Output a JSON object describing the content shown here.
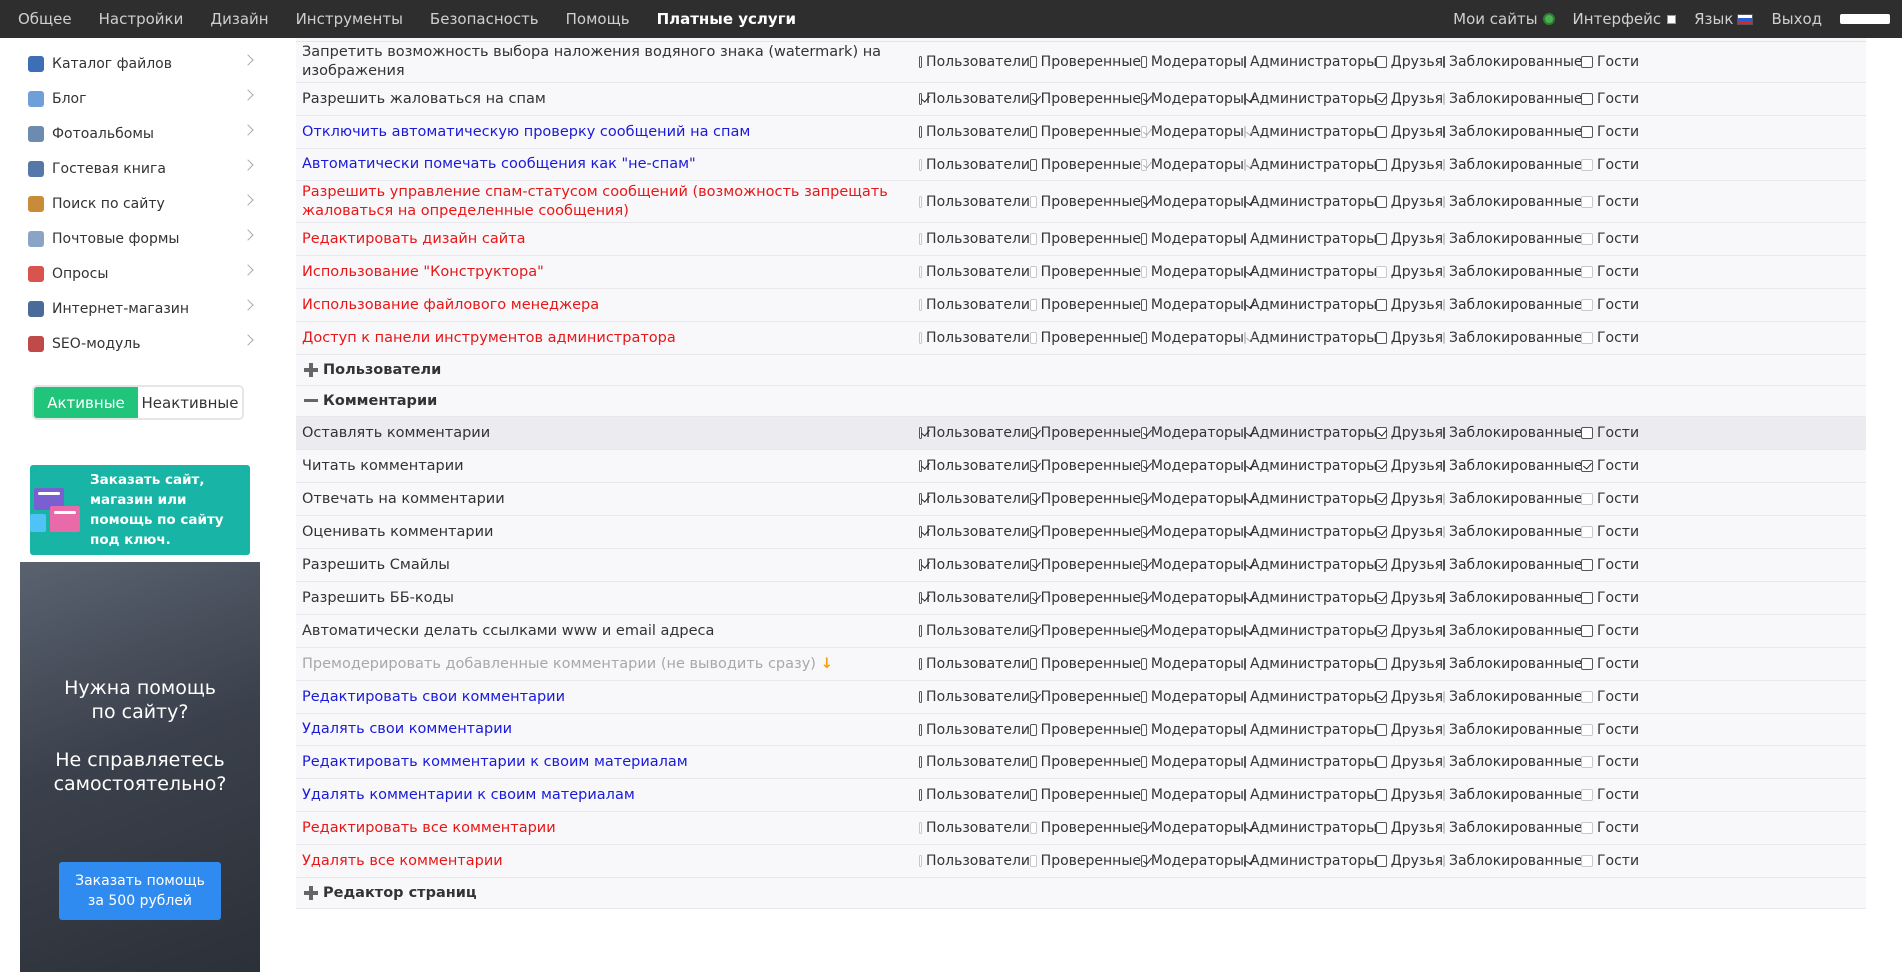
{
  "topnav": {
    "items": [
      "Общее",
      "Настройки",
      "Дизайн",
      "Инструменты",
      "Безопасность",
      "Помощь"
    ],
    "paid": "Платные услуги"
  },
  "topright": {
    "my_sites": "Мои сайты",
    "interface": "Интерфейс",
    "language": "Язык",
    "logout": "Выход"
  },
  "sidebar": {
    "items": [
      {
        "label": "Каталог файлов",
        "icon": "file-catalog-icon",
        "color": "#3d6fb6"
      },
      {
        "label": "Блог",
        "icon": "blog-icon",
        "color": "#6f9fd8"
      },
      {
        "label": "Фотоальбомы",
        "icon": "photo-album-icon",
        "color": "#6b8bb0"
      },
      {
        "label": "Гостевая книга",
        "icon": "guestbook-icon",
        "color": "#5577aa"
      },
      {
        "label": "Поиск по сайту",
        "icon": "search-icon",
        "color": "#c98a3a"
      },
      {
        "label": "Почтовые формы",
        "icon": "mail-form-icon",
        "color": "#8aa4c8"
      },
      {
        "label": "Опросы",
        "icon": "poll-icon",
        "color": "#d9534f"
      },
      {
        "label": "Интернет-магазин",
        "icon": "shop-icon",
        "color": "#4a6a9a"
      },
      {
        "label": "SEO-модуль",
        "icon": "seo-rocket-icon",
        "color": "#c04a4a"
      }
    ],
    "toggle_active": "Активные",
    "toggle_inactive": "Неактивные",
    "promo1": "Заказать сайт, магазин или помощь по сайту под ключ.",
    "promo2_q1_line1": "Нужна помощь",
    "promo2_q1_line2": "по сайту?",
    "promo2_q2_line1": "Не справляетесь",
    "promo2_q2_line2": "самостоятельно?",
    "promo2_btn_line1": "Заказать помощь",
    "promo2_btn_line2": "за 500 рублей"
  },
  "roles": [
    "Пользователи",
    "Проверенные",
    "Модераторы",
    "Администраторы",
    "Друзья",
    "Заблокированные",
    "Гости"
  ],
  "colors": {
    "blue": "#1a1ad9",
    "red": "#e81717",
    "gray": "#a8a8a8",
    "accent": "#20c47a"
  },
  "rows": [
    {
      "type": "row",
      "label": "Запретить возможность выбора наложения водяного знака (watermark) на изображения",
      "color": "normal",
      "h": 41,
      "checks": [
        [
          0,
          0
        ],
        [
          0,
          0
        ],
        [
          0,
          0
        ],
        [
          0,
          0
        ],
        [
          0,
          0
        ],
        [
          0,
          0
        ],
        [
          0,
          0
        ]
      ]
    },
    {
      "type": "row",
      "label": "Разрешить жаловаться на спам",
      "color": "normal",
      "h": 33,
      "checks": [
        [
          1,
          0
        ],
        [
          1,
          0
        ],
        [
          1,
          0
        ],
        [
          1,
          0
        ],
        [
          1,
          0
        ],
        [
          0,
          1
        ],
        [
          0,
          0
        ]
      ]
    },
    {
      "type": "row",
      "label": "Отключить автоматическую проверку сообщений на спам",
      "color": "blue",
      "h": 33,
      "checks": [
        [
          0,
          0
        ],
        [
          0,
          0
        ],
        [
          1,
          1
        ],
        [
          1,
          1
        ],
        [
          0,
          0
        ],
        [
          0,
          0
        ],
        [
          0,
          0
        ]
      ]
    },
    {
      "type": "row",
      "label": "Автоматически помечать сообщения как \"не-спам\"",
      "color": "blue",
      "h": 32,
      "checks": [
        [
          0,
          1
        ],
        [
          0,
          0
        ],
        [
          1,
          1
        ],
        [
          1,
          1
        ],
        [
          0,
          0
        ],
        [
          0,
          1
        ],
        [
          0,
          1
        ]
      ]
    },
    {
      "type": "row",
      "label": "Разрешить управление спам-статусом сообщений (возможность запрещать жаловаться на определенные сообщения)",
      "color": "red",
      "h": 42,
      "checks": [
        [
          0,
          1
        ],
        [
          0,
          1
        ],
        [
          1,
          0
        ],
        [
          1,
          0
        ],
        [
          0,
          0
        ],
        [
          0,
          1
        ],
        [
          0,
          1
        ]
      ]
    },
    {
      "type": "row",
      "label": "Редактировать дизайн сайта",
      "color": "red",
      "h": 33,
      "checks": [
        [
          0,
          1
        ],
        [
          0,
          1
        ],
        [
          0,
          0
        ],
        [
          0,
          0
        ],
        [
          0,
          0
        ],
        [
          0,
          1
        ],
        [
          0,
          1
        ]
      ]
    },
    {
      "type": "row",
      "label": "Использование \"Конструктора\"",
      "color": "red",
      "h": 33,
      "checks": [
        [
          0,
          1
        ],
        [
          0,
          1
        ],
        [
          0,
          1
        ],
        [
          1,
          0
        ],
        [
          0,
          1
        ],
        [
          0,
          1
        ],
        [
          0,
          1
        ]
      ]
    },
    {
      "type": "row",
      "label": "Использование файлового менеджера",
      "color": "red",
      "h": 33,
      "checks": [
        [
          0,
          1
        ],
        [
          0,
          1
        ],
        [
          0,
          0
        ],
        [
          1,
          0
        ],
        [
          0,
          0
        ],
        [
          0,
          1
        ],
        [
          0,
          1
        ]
      ]
    },
    {
      "type": "row",
      "label": "Доступ к панели инструментов администратора",
      "color": "red",
      "h": 33,
      "checks": [
        [
          0,
          1
        ],
        [
          0,
          1
        ],
        [
          0,
          0
        ],
        [
          1,
          1
        ],
        [
          0,
          0
        ],
        [
          0,
          1
        ],
        [
          0,
          1
        ]
      ]
    },
    {
      "type": "group",
      "label": "Пользователи",
      "icon": "plus"
    },
    {
      "type": "group",
      "label": "Комментарии",
      "icon": "minus"
    },
    {
      "type": "row",
      "label": "Оставлять комментарии",
      "color": "normal",
      "h": 33,
      "hl": true,
      "checks": [
        [
          1,
          0
        ],
        [
          1,
          0
        ],
        [
          1,
          0
        ],
        [
          1,
          0
        ],
        [
          1,
          0
        ],
        [
          0,
          0
        ],
        [
          0,
          0
        ]
      ]
    },
    {
      "type": "row",
      "label": "Читать комментарии",
      "color": "normal",
      "h": 33,
      "checks": [
        [
          1,
          0
        ],
        [
          1,
          0
        ],
        [
          1,
          0
        ],
        [
          1,
          0
        ],
        [
          1,
          0
        ],
        [
          0,
          0
        ],
        [
          1,
          0
        ]
      ]
    },
    {
      "type": "row",
      "label": "Отвечать на комментарии",
      "color": "normal",
      "h": 33,
      "checks": [
        [
          1,
          0
        ],
        [
          1,
          0
        ],
        [
          1,
          0
        ],
        [
          1,
          0
        ],
        [
          1,
          0
        ],
        [
          0,
          1
        ],
        [
          0,
          1
        ]
      ]
    },
    {
      "type": "row",
      "label": "Оценивать комментарии",
      "color": "normal",
      "h": 33,
      "checks": [
        [
          1,
          0
        ],
        [
          1,
          0
        ],
        [
          1,
          0
        ],
        [
          1,
          0
        ],
        [
          1,
          0
        ],
        [
          0,
          1
        ],
        [
          0,
          1
        ]
      ]
    },
    {
      "type": "row",
      "label": "Разрешить Смайлы",
      "color": "normal",
      "h": 33,
      "checks": [
        [
          1,
          0
        ],
        [
          1,
          0
        ],
        [
          1,
          0
        ],
        [
          1,
          0
        ],
        [
          1,
          0
        ],
        [
          0,
          0
        ],
        [
          0,
          0
        ]
      ]
    },
    {
      "type": "row",
      "label": "Разрешить ББ-коды",
      "color": "normal",
      "h": 33,
      "checks": [
        [
          1,
          0
        ],
        [
          1,
          0
        ],
        [
          1,
          0
        ],
        [
          1,
          0
        ],
        [
          1,
          0
        ],
        [
          0,
          0
        ],
        [
          0,
          0
        ]
      ]
    },
    {
      "type": "row",
      "label": "Автоматически делать ссылками www и email адреса",
      "color": "normal",
      "h": 33,
      "checks": [
        [
          0,
          0
        ],
        [
          1,
          0
        ],
        [
          1,
          0
        ],
        [
          1,
          0
        ],
        [
          1,
          0
        ],
        [
          0,
          0
        ],
        [
          0,
          0
        ]
      ]
    },
    {
      "type": "row",
      "label": "Премодерировать добавленные комментарии (не выводить сразу)",
      "color": "gray",
      "h": 33,
      "arrow": "↓",
      "checks": [
        [
          0,
          0
        ],
        [
          0,
          0
        ],
        [
          0,
          0
        ],
        [
          0,
          0
        ],
        [
          0,
          0
        ],
        [
          0,
          0
        ],
        [
          0,
          0
        ]
      ]
    },
    {
      "type": "row",
      "label": "Редактировать свои комментарии",
      "color": "blue",
      "h": 33,
      "checks": [
        [
          0,
          0
        ],
        [
          1,
          0
        ],
        [
          0,
          0
        ],
        [
          0,
          0
        ],
        [
          1,
          0
        ],
        [
          0,
          1
        ],
        [
          0,
          1
        ]
      ]
    },
    {
      "type": "row",
      "label": "Удалять свои комментарии",
      "color": "blue",
      "h": 32,
      "checks": [
        [
          0,
          0
        ],
        [
          0,
          0
        ],
        [
          0,
          0
        ],
        [
          0,
          0
        ],
        [
          0,
          0
        ],
        [
          0,
          1
        ],
        [
          0,
          1
        ]
      ]
    },
    {
      "type": "row",
      "label": "Редактировать комментарии к своим материалам",
      "color": "blue",
      "h": 33,
      "checks": [
        [
          0,
          0
        ],
        [
          0,
          0
        ],
        [
          0,
          0
        ],
        [
          0,
          0
        ],
        [
          0,
          0
        ],
        [
          0,
          1
        ],
        [
          0,
          1
        ]
      ]
    },
    {
      "type": "row",
      "label": "Удалять комментарии к своим материалам",
      "color": "blue",
      "h": 33,
      "checks": [
        [
          0,
          0
        ],
        [
          0,
          0
        ],
        [
          0,
          0
        ],
        [
          0,
          0
        ],
        [
          0,
          0
        ],
        [
          0,
          1
        ],
        [
          0,
          1
        ]
      ]
    },
    {
      "type": "row",
      "label": "Редактировать все комментарии",
      "color": "red",
      "h": 33,
      "checks": [
        [
          0,
          1
        ],
        [
          0,
          1
        ],
        [
          1,
          0
        ],
        [
          1,
          0
        ],
        [
          0,
          0
        ],
        [
          0,
          1
        ],
        [
          0,
          1
        ]
      ]
    },
    {
      "type": "row",
      "label": "Удалять все комментарии",
      "color": "red",
      "h": 33,
      "checks": [
        [
          0,
          1
        ],
        [
          0,
          1
        ],
        [
          1,
          0
        ],
        [
          1,
          0
        ],
        [
          0,
          0
        ],
        [
          0,
          1
        ],
        [
          0,
          1
        ]
      ]
    },
    {
      "type": "group",
      "label": "Редактор страниц",
      "icon": "plus"
    }
  ]
}
